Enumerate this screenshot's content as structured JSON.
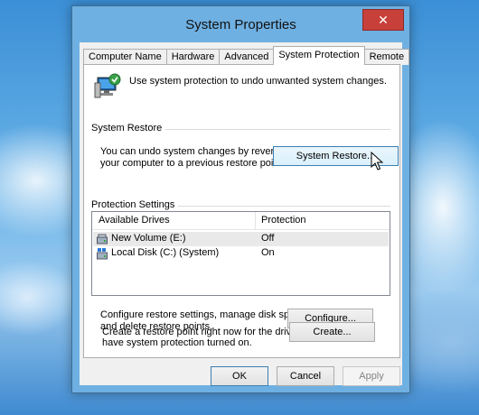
{
  "window": {
    "title": "System Properties",
    "close_label": "✕"
  },
  "tabs": [
    {
      "label": "Computer Name"
    },
    {
      "label": "Hardware"
    },
    {
      "label": "Advanced"
    },
    {
      "label": "System Protection",
      "active": true
    },
    {
      "label": "Remote"
    }
  ],
  "intro": {
    "icon": "system-protection-icon",
    "text": "Use system protection to undo unwanted system changes."
  },
  "system_restore": {
    "group_label": "System Restore",
    "description_line1": "You can undo system changes by reverting",
    "description_line2": "your computer to a previous restore point.",
    "button_label": "System Restore..."
  },
  "protection_settings": {
    "group_label": "Protection Settings",
    "columns": [
      "Available Drives",
      "Protection"
    ],
    "drives": [
      {
        "name": "New Volume (E:)",
        "protection": "Off",
        "icon": "removable-drive-icon"
      },
      {
        "name": "Local Disk (C:) (System)",
        "protection": "On",
        "icon": "system-drive-icon"
      }
    ],
    "configure_text_line1": "Configure restore settings, manage disk space,",
    "configure_text_line2": "and delete restore points.",
    "configure_label": "Configure...",
    "create_text_line1": "Create a restore point right now for the drives that",
    "create_text_line2": "have system protection turned on.",
    "create_label": "Create..."
  },
  "footer": {
    "ok_label": "OK",
    "cancel_label": "Cancel",
    "apply_label": "Apply"
  },
  "colors": {
    "accent": "#3c7fb1",
    "close": "#c7403a",
    "titlebar": "#6fb0e2"
  }
}
